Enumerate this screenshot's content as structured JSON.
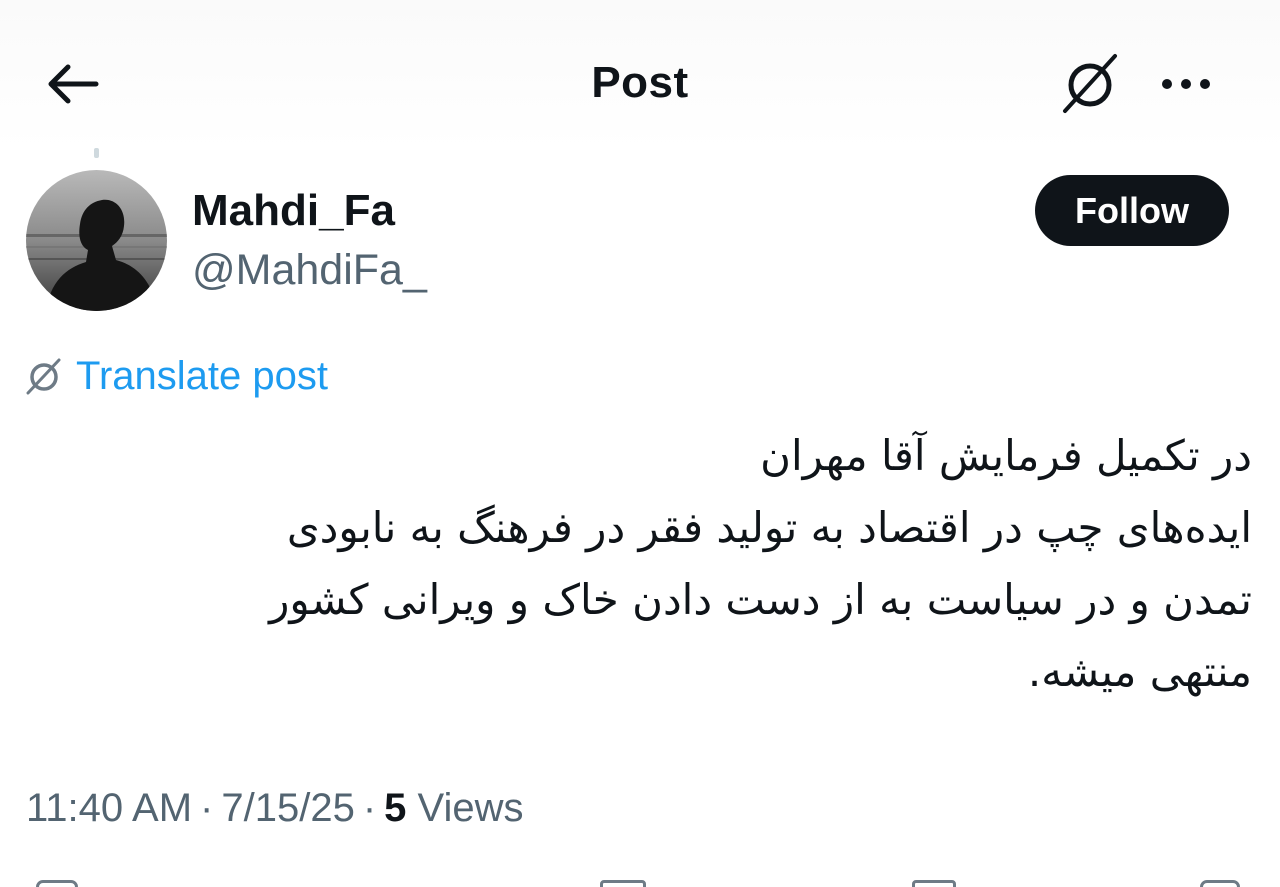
{
  "header": {
    "title": "Post",
    "back_icon": "arrow-left-icon",
    "translate_icon": "translate-icon",
    "more_icon": "more-horizontal-icon"
  },
  "author": {
    "display_name": "Mahdi_Fa",
    "handle": "@MahdiFa_",
    "follow_label": "Follow"
  },
  "translate": {
    "label": "Translate post",
    "icon": "translate-icon"
  },
  "post": {
    "lines": [
      "در تکمیل فرمایش آقا مهران",
      "ایده‌های چپ در اقتصاد به تولید فقر در فرهنگ به نابودی",
      "تمدن و در سیاست به از دست دادن خاک و ویرانی کشور",
      "منتهی میشه."
    ]
  },
  "meta": {
    "time": "11:40 AM",
    "date": "7/15/25",
    "separator": "·",
    "views_count": "5",
    "views_label": "Views"
  },
  "colors": {
    "text": "#0f1419",
    "secondary": "#536471",
    "accent": "#1d9bf0",
    "button_bg": "#0f1419"
  }
}
